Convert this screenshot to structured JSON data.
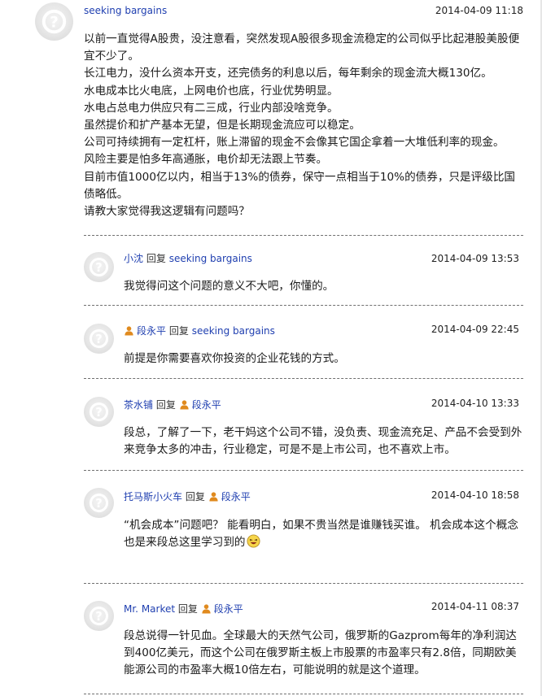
{
  "thread": {
    "post": {
      "author": "seeking bargains",
      "time": "2014-04-09 11:18",
      "lines": [
        "以前一直觉得A股贵，没注意看，突然发现A股很多现金流稳定的公司似乎比起港股美股便宜不少了。",
        "长江电力，没什么资本开支，还完债务的利息以后，每年剩余的现金流大概130亿。",
        "水电成本比火电底，上网电价也底，行业优势明显。",
        "水电占总电力供应只有二三成，行业内部没啥竞争。",
        "虽然提价和扩产基本无望，但是长期现金流应可以稳定。",
        "公司可持续拥有一定杠杆，账上滞留的现金不会像其它国企拿着一大堆低利率的现金。",
        "风险主要是怕多年高通胀，电价却无法跟上节奏。",
        "目前市值1000亿以内，相当于13%的债券，保守一点相当于10%的债券，只是评级比国债略低。",
        "请教大家觉得我这逻辑有问题吗？"
      ]
    },
    "replies": [
      {
        "author": "小沈",
        "reply_word": "回复",
        "target": "seeking bargains",
        "time": "2014-04-09 13:53",
        "text": "我觉得问这个问题的意义不大吧，你懂的。"
      },
      {
        "author": "段永平",
        "reply_word": "回复",
        "target": "seeking bargains",
        "time": "2014-04-09 22:45",
        "text": "前提是你需要喜欢你投资的企业花钱的方式。"
      },
      {
        "author": "茶水铺",
        "reply_word": "回复",
        "target": "段永平",
        "time": "2014-04-10 13:33",
        "text": "段总，了解了一下，老干妈这个公司不错，没负责、现金流充足、产品不会受到外来竞争太多的冲击，行业稳定，可是不是上市公司，也不喜欢上市。"
      },
      {
        "author": "托马斯小火车",
        "reply_word": "回复",
        "target": "段永平",
        "time": "2014-04-10 18:58",
        "text": "“机会成本”问题吧？ 能看明白，如果不贵当然是谁赚钱买谁。 机会成本这个概念也是来段总这里学习到的"
      },
      {
        "author": "Mr. Market",
        "reply_word": "回复",
        "target": "段永平",
        "time": "2014-04-11 08:37",
        "text": "段总说得一针见血。全球最大的天然气公司，俄罗斯的Gazprom每年的净利润达到400亿美元，而这个公司在俄罗斯主板上市股票的市盈率只有2.8倍，同期欧美能源公司的市盈率大概10倍左右，可能说明的就是这个道理。"
      }
    ]
  },
  "colors": {
    "username": "#1f3fb0",
    "divider": "#6f6f6f",
    "user_badge": "#e08a1e"
  },
  "icons": {
    "avatar": "default-avatar-question-icon",
    "badge": "user-badge-icon",
    "emoji": "laughing-emoji-icon"
  }
}
